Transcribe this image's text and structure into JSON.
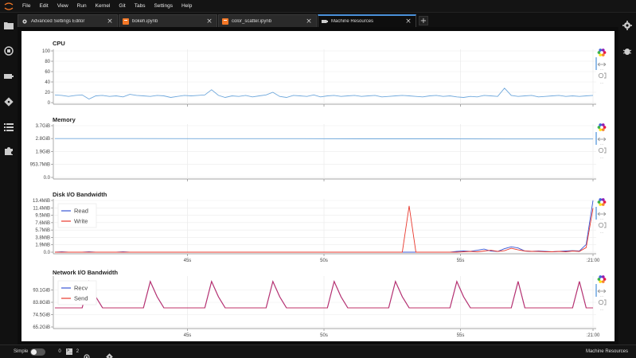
{
  "menu": [
    "File",
    "Edit",
    "View",
    "Run",
    "Kernel",
    "Git",
    "Tabs",
    "Settings",
    "Help"
  ],
  "tabs": [
    {
      "label": "Advanced Settings Editor",
      "icon": "gear-icon",
      "active": false
    },
    {
      "label": "bokeh.ipynb",
      "icon": "notebook-icon",
      "active": false
    },
    {
      "label": "color_scatter.ipynb",
      "icon": "notebook-icon",
      "active": false
    },
    {
      "label": "Machine Resources",
      "icon": "gpu-icon",
      "active": true
    }
  ],
  "statusbar": {
    "mode_label": "Simple",
    "terminals_count": "0",
    "kernels_count": "2",
    "right_label": "Machine Resources"
  },
  "colors": {
    "blue": "#1f77b4",
    "red": "#e8382d",
    "purple": "#8b1a7a",
    "accent": "#4a90d9"
  },
  "chart_data": [
    {
      "type": "line",
      "title": "CPU",
      "x_ticks": [
        "45s",
        "50s",
        "55s",
        ":21:00"
      ],
      "y_ticks": [
        "100",
        "80",
        "60",
        "40",
        "20",
        "0"
      ],
      "ylim": [
        0,
        100
      ],
      "series": [
        {
          "color": "#6fa8dc",
          "values": [
            15,
            14,
            12,
            14,
            15,
            7,
            13,
            14,
            12,
            13,
            11,
            16,
            14,
            13,
            12,
            14,
            13,
            10,
            12,
            14,
            13,
            14,
            15,
            25,
            14,
            10,
            13,
            12,
            14,
            11,
            13,
            15,
            20,
            12,
            10,
            14,
            13,
            12,
            15,
            11,
            13,
            14,
            12,
            13,
            14,
            12,
            13,
            14,
            11,
            12,
            13,
            14,
            13,
            12,
            11,
            13,
            14,
            12,
            13,
            11,
            10,
            12,
            11,
            14,
            13,
            12,
            28,
            14,
            12,
            13,
            14,
            11,
            12,
            13,
            14,
            12,
            13,
            12,
            13,
            14
          ]
        }
      ]
    },
    {
      "type": "line",
      "title": "Memory",
      "x_ticks": [
        "45s",
        "50s",
        "55s",
        ":21:00"
      ],
      "y_ticks": [
        "3.7GiB",
        "2.8GiB",
        "1.9GiB",
        "953.7MiB",
        "0.0"
      ],
      "ylim": [
        0,
        3.7
      ],
      "series": [
        {
          "color": "#6fa8dc",
          "values": [
            2.78,
            2.78,
            2.77,
            2.77,
            2.76,
            2.76,
            2.75,
            2.75
          ]
        }
      ]
    },
    {
      "type": "line",
      "title": "Disk I/O Bandwidth",
      "x_ticks": [
        "45s",
        "50s",
        "55s",
        ":21:00"
      ],
      "y_ticks": [
        "13.4MiB",
        "11.4MiB",
        "9.5MiB",
        "7.6MiB",
        "5.7MiB",
        "3.8MiB",
        "1.9MiB",
        "0.0"
      ],
      "ylim": [
        0,
        13.4
      ],
      "series": [
        {
          "name": "Read",
          "color": "#3a56d4",
          "values": [
            0,
            0.1,
            0,
            0,
            0,
            0.1,
            0,
            0,
            0,
            0,
            0.1,
            0,
            0,
            0,
            0,
            0,
            0,
            0,
            0,
            0,
            0,
            0,
            0,
            0,
            0,
            0,
            0,
            0,
            0,
            0,
            0,
            0,
            0,
            0,
            0,
            0,
            0,
            0,
            0,
            0,
            0,
            0,
            0,
            0,
            0,
            0,
            0,
            0,
            0,
            0,
            0,
            0,
            0,
            0,
            0,
            0,
            0,
            0,
            0,
            0.2,
            0.3,
            0.2,
            0.5,
            0.8,
            0.3,
            0.2,
            0.9,
            1.4,
            1.1,
            0.3,
            0.2,
            0.3,
            0.2,
            0.1,
            0.2,
            0.3,
            0.4,
            0.3,
            2.0,
            13.4
          ]
        },
        {
          "name": "Write",
          "color": "#e8382d",
          "values": [
            0,
            0,
            0,
            0,
            0,
            0,
            0,
            0,
            0,
            0,
            0,
            0,
            0,
            0,
            0,
            0,
            0,
            0,
            0,
            0,
            0,
            0,
            0,
            0,
            0,
            0,
            0,
            0,
            0,
            0,
            0,
            0,
            0,
            0,
            0,
            0,
            0,
            0,
            0,
            0,
            0,
            0,
            0,
            0,
            0,
            0,
            0,
            0,
            0,
            0,
            0,
            0,
            12.0,
            0,
            0,
            0,
            0,
            0,
            0,
            0,
            0.1,
            0.2,
            0.1,
            0.3,
            0.5,
            0.2,
            0.4,
            1.0,
            0.6,
            0.3,
            0.2,
            0.2,
            0.1,
            0.1,
            0.2,
            0.1,
            0.3,
            0.2,
            1.2,
            11.4
          ]
        }
      ]
    },
    {
      "type": "line",
      "title": "Network I/O Bandwidth",
      "x_ticks": [
        "45s",
        "50s",
        "55s",
        ":21:00"
      ],
      "y_ticks": [
        "93.1GiB",
        "83.8GiB",
        "74.5GiB",
        "65.2GiB"
      ],
      "ylim": [
        65.2,
        102.4
      ],
      "series": [
        {
          "name": "Recv",
          "color": "#3a56d4",
          "values": []
        },
        {
          "name": "Send",
          "color": "#e8382d",
          "values": []
        }
      ]
    }
  ]
}
